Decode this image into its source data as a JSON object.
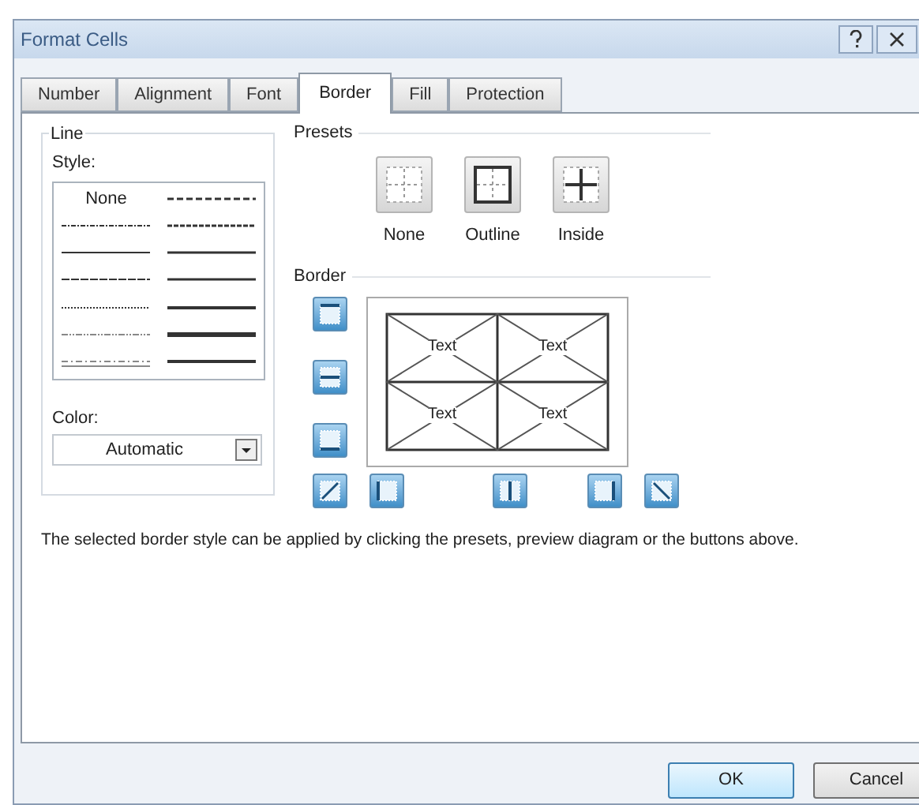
{
  "window": {
    "title": "Format Cells"
  },
  "tabs": [
    {
      "label": "Number",
      "selected": false
    },
    {
      "label": "Alignment",
      "selected": false
    },
    {
      "label": "Font",
      "selected": false
    },
    {
      "label": "Border",
      "selected": true
    },
    {
      "label": "Fill",
      "selected": false
    },
    {
      "label": "Protection",
      "selected": false
    }
  ],
  "line": {
    "title": "Line",
    "style_label": "Style:",
    "none_label": "None",
    "color_label": "Color:",
    "color_value": "Automatic"
  },
  "presets": {
    "title": "Presets",
    "items": [
      {
        "label": "None",
        "kind": "none"
      },
      {
        "label": "Outline",
        "kind": "outline"
      },
      {
        "label": "Inside",
        "kind": "inside"
      }
    ]
  },
  "border": {
    "title": "Border",
    "preview_texts": [
      "Text",
      "Text",
      "Text",
      "Text"
    ]
  },
  "description": "The selected border style can be applied by clicking the presets, preview diagram or the buttons above.",
  "buttons": [
    {
      "label": "OK",
      "kind": "default"
    },
    {
      "label": "Cancel",
      "kind": "normal"
    }
  ]
}
